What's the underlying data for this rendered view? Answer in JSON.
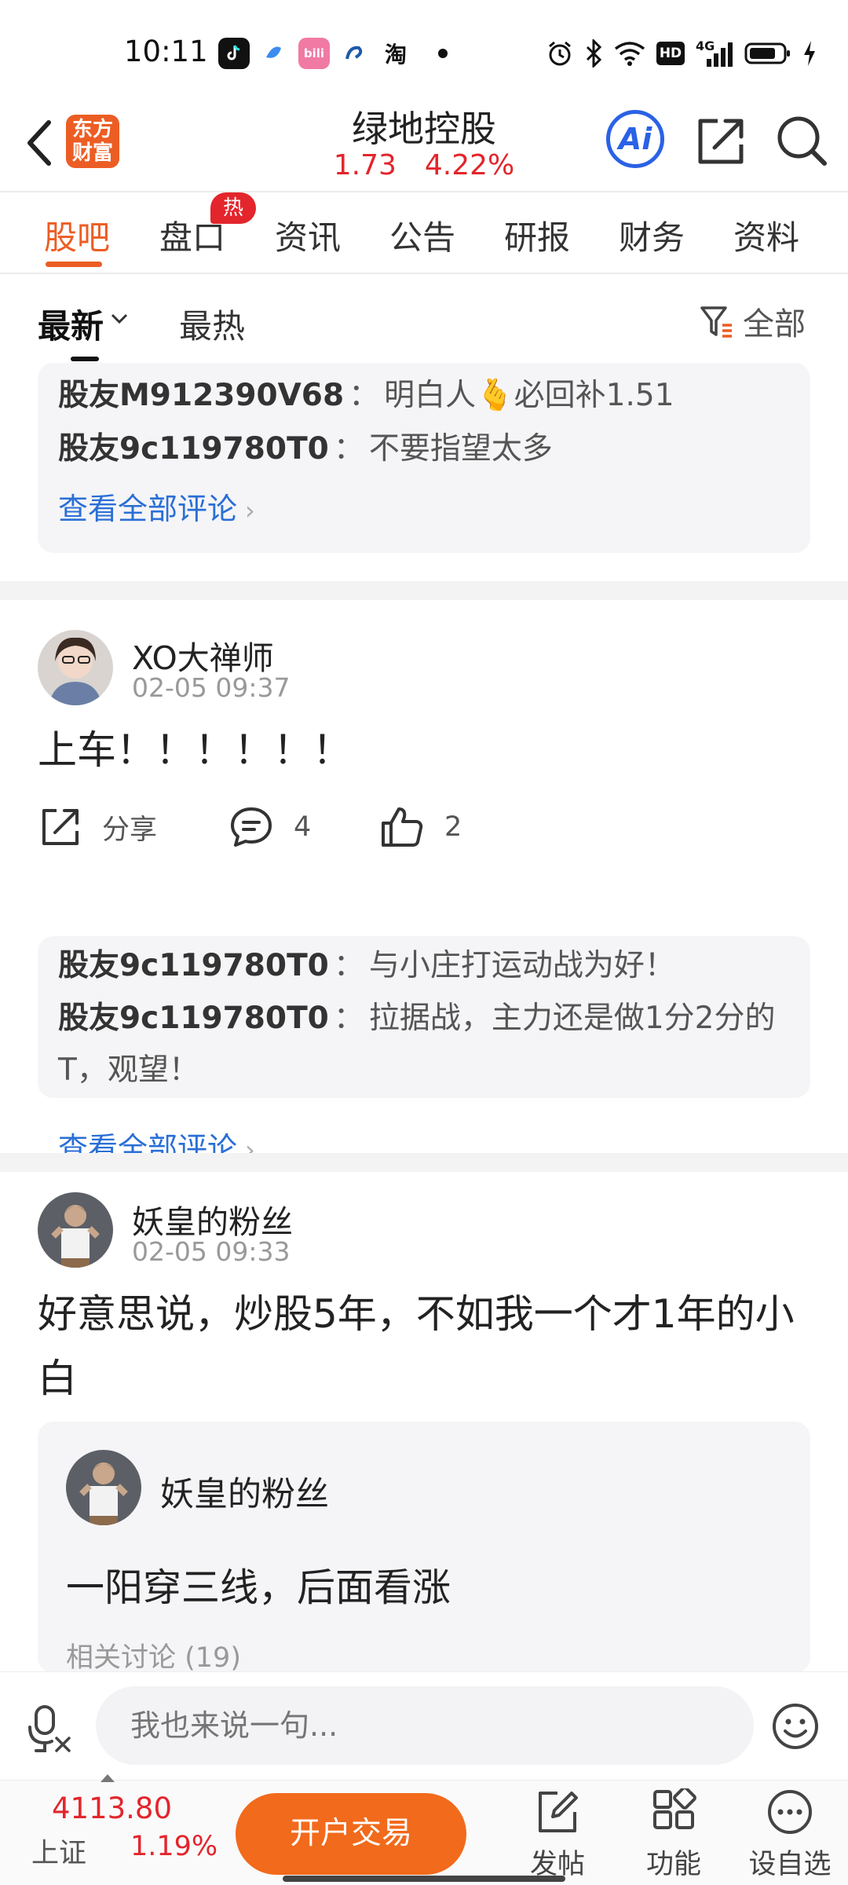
{
  "status_bar": {
    "time": "10:11",
    "taobao_label": "淘",
    "hd_label": "HD",
    "network_label": "4G"
  },
  "header": {
    "logo_line1": "东方",
    "logo_line2": "财富",
    "title": "绿地控股",
    "price": "1.73",
    "change_pct": "4.22%",
    "ai_label": "Ai"
  },
  "tabs": {
    "items": [
      "股吧",
      "盘口",
      "资讯",
      "公告",
      "研报",
      "财务",
      "资料"
    ],
    "hot_badge": "热"
  },
  "sort": {
    "latest": "最新",
    "hot": "最热",
    "filter": "全部"
  },
  "feed": {
    "top_comments": [
      {
        "user": "股友M912390V68",
        "sep": "：",
        "text": "明白人🫰必回补1.51"
      },
      {
        "user": "股友9c119780T0",
        "sep": "：",
        "text": "不要指望太多"
      }
    ],
    "see_all": "查看全部评论",
    "posts": [
      {
        "user": "XO大禅师",
        "time": "02-05 09:37",
        "content": "上车！！！！！！",
        "share_label": "分享",
        "comment_count": "4",
        "like_count": "2",
        "comments": [
          {
            "user": "股友9c119780T0",
            "sep": "：",
            "text": "与小庄打运动战为好！"
          },
          {
            "user": "股友9c119780T0",
            "sep": "：",
            "text": "拉据战，主力还是做1分2分的T，观望！"
          }
        ]
      },
      {
        "user": "妖皇的粉丝",
        "time": "02-05 09:33",
        "content": "好意思说，炒股5年，不如我一个才1年的小白",
        "quote": {
          "user": "妖皇的粉丝",
          "text": "一阳穿三线，后面看涨",
          "related": "相关讨论 (19)"
        }
      }
    ]
  },
  "input_bar": {
    "placeholder": "我也来说一句..."
  },
  "bottom_bar": {
    "index_value": "4113.80",
    "index_name": "上证",
    "index_change": "1.19%",
    "open_account": "开户交易",
    "nav": [
      "发帖",
      "功能",
      "设自选"
    ]
  },
  "colors": {
    "accent": "#ec5d24",
    "up_red": "#e3252c",
    "link_blue": "#2a6fd6",
    "ai_blue": "#2a62e6"
  }
}
